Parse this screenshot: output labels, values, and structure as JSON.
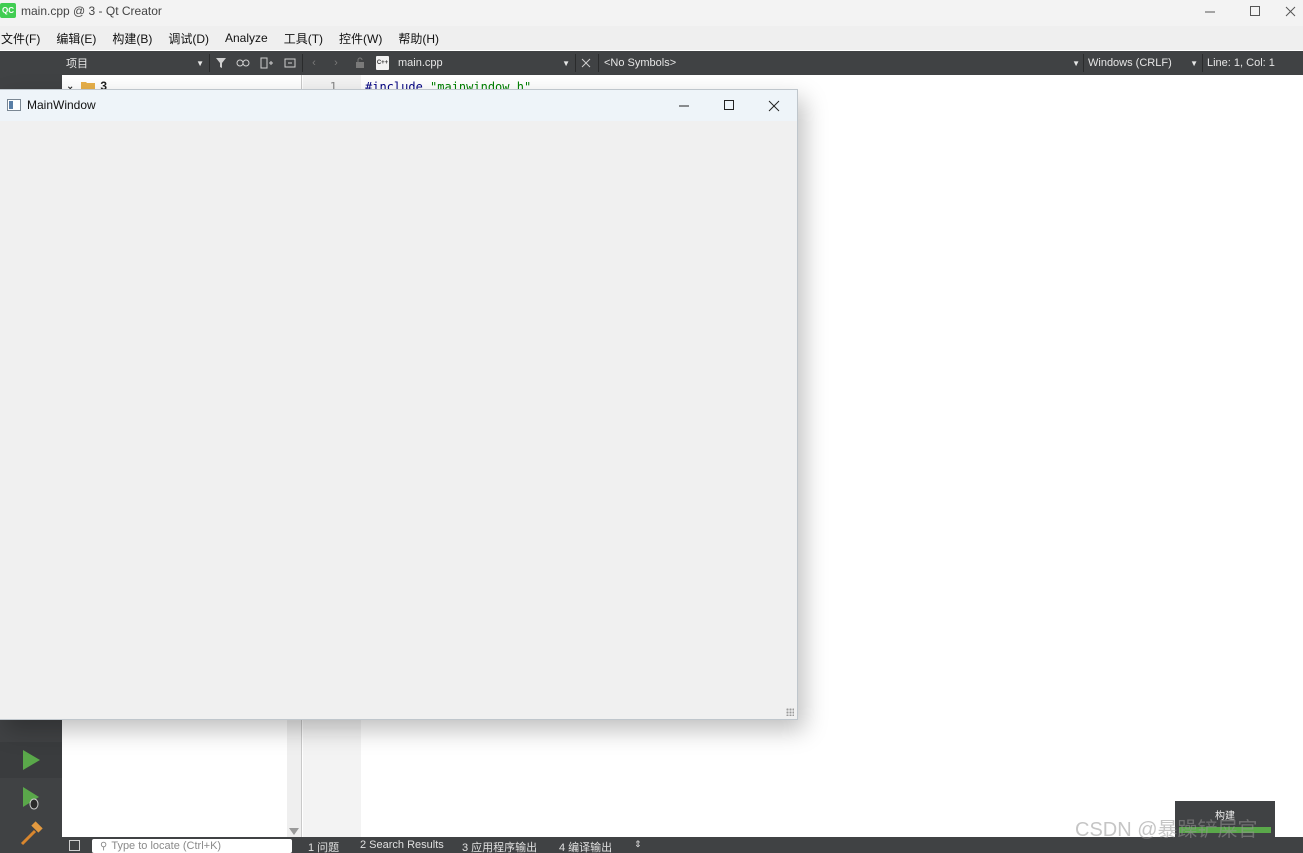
{
  "window": {
    "title": "main.cpp @ 3 - Qt Creator",
    "logo_text": "QC"
  },
  "menu": [
    "文件(F)",
    "编辑(E)",
    "构建(B)",
    "调试(D)",
    "Analyze",
    "工具(T)",
    "控件(W)",
    "帮助(H)"
  ],
  "toolbar": {
    "panel_select": "项目",
    "file_name": "main.cpp",
    "file_badge": "C++",
    "symbols": "<No Symbols>",
    "line_endings": "Windows (CRLF)",
    "cursor_position": "Line: 1, Col: 1"
  },
  "project_tree": {
    "root_name": "3"
  },
  "editor": {
    "line_number": "1",
    "code_keyword": "#include",
    "code_string": "\"mainwindow.h\""
  },
  "app_window": {
    "title": "MainWindow"
  },
  "build_popup": {
    "label": "构建"
  },
  "statusbar": {
    "locate_placeholder": "Type to locate (Ctrl+K)",
    "tabs": [
      "1 问题",
      "2 Search Results",
      "3 应用程序输出",
      "4 编译输出"
    ]
  },
  "watermark": "CSDN @暴躁铲屎官",
  "colors": {
    "dark_panel": "#404244",
    "run_green": "#5aa84a",
    "qt_green": "#41cd52"
  }
}
